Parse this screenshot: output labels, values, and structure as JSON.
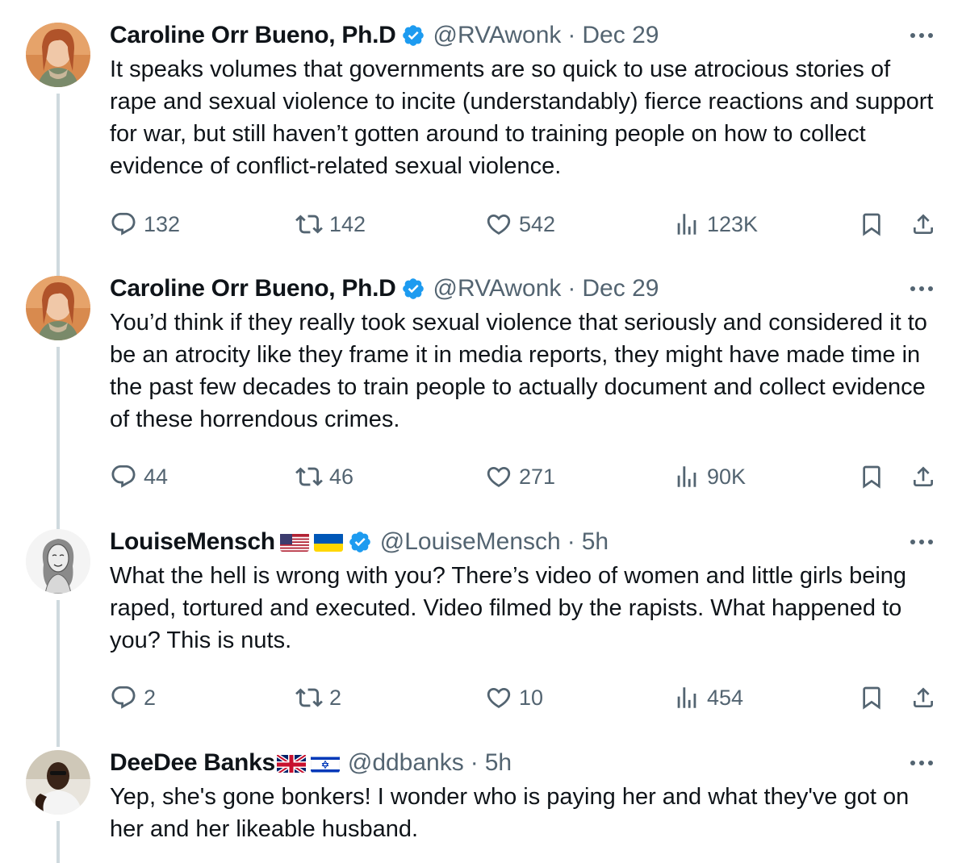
{
  "colors": {
    "text": "#0f1419",
    "secondary": "#536471",
    "verified": "#1d9bf0",
    "thread_line": "#cfd9de"
  },
  "tweets": [
    {
      "name": "Caroline Orr Bueno, Ph.D",
      "handle": "@RVAwonk",
      "separator": "·",
      "time": "Dec 29",
      "verified": true,
      "flags": [],
      "text": "It speaks volumes that governments are so quick to use atrocious stories of rape and sexual violence to incite (understandably) fierce reactions and support for war, but still haven’t gotten around to training people on how to collect evidence of conflict-related sexual violence.",
      "replies": "132",
      "retweets": "142",
      "likes": "542",
      "views": "123K"
    },
    {
      "name": "Caroline Orr Bueno, Ph.D",
      "handle": "@RVAwonk",
      "separator": "·",
      "time": "Dec 29",
      "verified": true,
      "flags": [],
      "text": "You’d think if they really took sexual violence that seriously and considered it to be an atrocity like they frame it in media reports, they might have made time in the past few decades to train people to actually document and collect evidence of these horrendous crimes.",
      "replies": "44",
      "retweets": "46",
      "likes": "271",
      "views": "90K"
    },
    {
      "name": "LouiseMensch",
      "handle": "@LouiseMensch",
      "separator": "·",
      "time": "5h",
      "verified": true,
      "flags": [
        "us-flag",
        "ukraine-flag"
      ],
      "text": "What the hell is wrong with you? There’s video of women and little girls being raped, tortured and executed. Video filmed by the rapists. What happened to you? This is nuts.",
      "replies": "2",
      "retweets": "2",
      "likes": "10",
      "views": "454"
    },
    {
      "name": "DeeDee Banks",
      "handle": "@ddbanks",
      "separator": "·",
      "time": "5h",
      "verified": false,
      "flags": [
        "uk-flag",
        "israel-flag"
      ],
      "text": "Yep, she's gone bonkers! I wonder who is paying her and what they've got on her and her likeable husband."
    }
  ]
}
